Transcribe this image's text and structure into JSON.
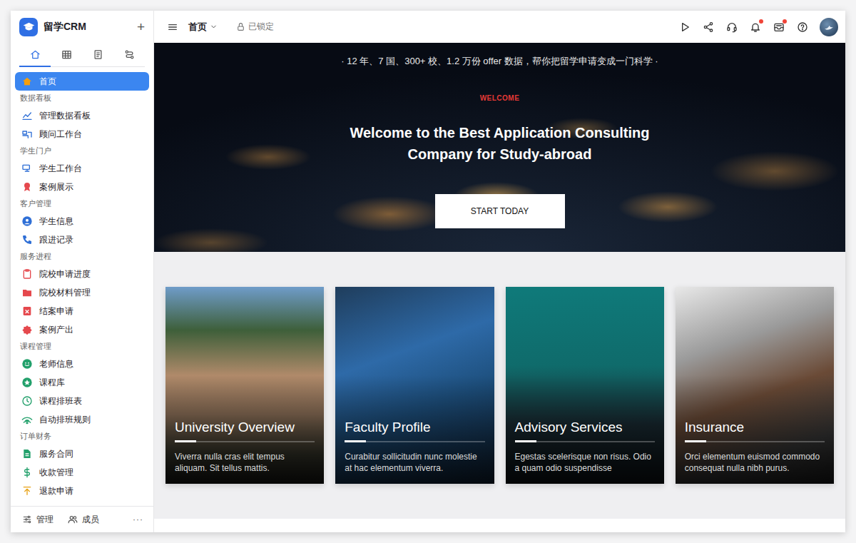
{
  "app": {
    "logo_text": "留学CRM",
    "add": "+"
  },
  "sidebar": {
    "tabs": [
      {
        "selected": true
      },
      {
        "selected": false
      },
      {
        "selected": false
      },
      {
        "selected": false
      }
    ],
    "items": [
      {
        "kind": "item",
        "label": "首页",
        "selected": true,
        "color": "#f59e0b"
      },
      {
        "kind": "header",
        "label": "数据看板"
      },
      {
        "kind": "item",
        "label": "管理数据看板",
        "selected": false,
        "color": "#2f6fd6"
      },
      {
        "kind": "item",
        "label": "顾问工作台",
        "selected": false,
        "color": "#2f6fd6"
      },
      {
        "kind": "header",
        "label": "学生门户"
      },
      {
        "kind": "item",
        "label": "学生工作台",
        "selected": false,
        "color": "#2f6fd6"
      },
      {
        "kind": "item",
        "label": "案例展示",
        "selected": false,
        "color": "#e5484d"
      },
      {
        "kind": "header",
        "label": "客户管理"
      },
      {
        "kind": "item",
        "label": "学生信息",
        "selected": false,
        "color": "#2f6fd6"
      },
      {
        "kind": "item",
        "label": "跟进记录",
        "selected": false,
        "color": "#2f6fd6"
      },
      {
        "kind": "header",
        "label": "服务进程"
      },
      {
        "kind": "item",
        "label": "院校申请进度",
        "selected": false,
        "color": "#e5484d"
      },
      {
        "kind": "item",
        "label": "院校材料管理",
        "selected": false,
        "color": "#e5484d"
      },
      {
        "kind": "item",
        "label": "结案申请",
        "selected": false,
        "color": "#e5484d"
      },
      {
        "kind": "item",
        "label": "案例产出",
        "selected": false,
        "color": "#e5484d"
      },
      {
        "kind": "header",
        "label": "课程管理"
      },
      {
        "kind": "item",
        "label": "老师信息",
        "selected": false,
        "color": "#22a06b"
      },
      {
        "kind": "item",
        "label": "课程库",
        "selected": false,
        "color": "#22a06b"
      },
      {
        "kind": "item",
        "label": "课程排班表",
        "selected": false,
        "color": "#22a06b"
      },
      {
        "kind": "item",
        "label": "自动排班规则",
        "selected": false,
        "color": "#22a06b"
      },
      {
        "kind": "header",
        "label": "订单财务"
      },
      {
        "kind": "item",
        "label": "服务合同",
        "selected": false,
        "color": "#22a06b"
      },
      {
        "kind": "item",
        "label": "收款管理",
        "selected": false,
        "color": "#22a06b"
      },
      {
        "kind": "item",
        "label": "退款申请",
        "selected": false,
        "color": "#e8a317"
      }
    ],
    "bottom": [
      "管理",
      "成员",
      "···"
    ]
  },
  "topbar": {
    "breadcrumb": "首页",
    "lock": "已锁定",
    "tools": [
      {
        "badge": false
      },
      {
        "badge": false
      },
      {
        "badge": false
      },
      {
        "badge": true
      },
      {
        "badge": true
      },
      {
        "badge": false
      }
    ]
  },
  "hero": {
    "tagline": "· 12 年、7 国、300+ 校、1.2 万份 offer 数据，帮你把留学申请变成一门科学 ·",
    "eyebrow": "WELCOME",
    "title": "Welcome to the Best Application Consulting Company for Study-abroad",
    "button": "START TODAY"
  },
  "cards": [
    {
      "title": "University Overview",
      "text": "Viverra nulla cras elit tempus aliquam. Sit tellus mattis."
    },
    {
      "title": "Faculty Profile",
      "text": "Curabitur sollicitudin nunc molestie at hac elementum viverra."
    },
    {
      "title": "Advisory Services",
      "text": "Egestas scelerisque non risus. Odio a quam odio suspendisse"
    },
    {
      "title": "Insurance",
      "text": "Orci elementum euismod commodo consequat nulla nibh purus."
    }
  ]
}
